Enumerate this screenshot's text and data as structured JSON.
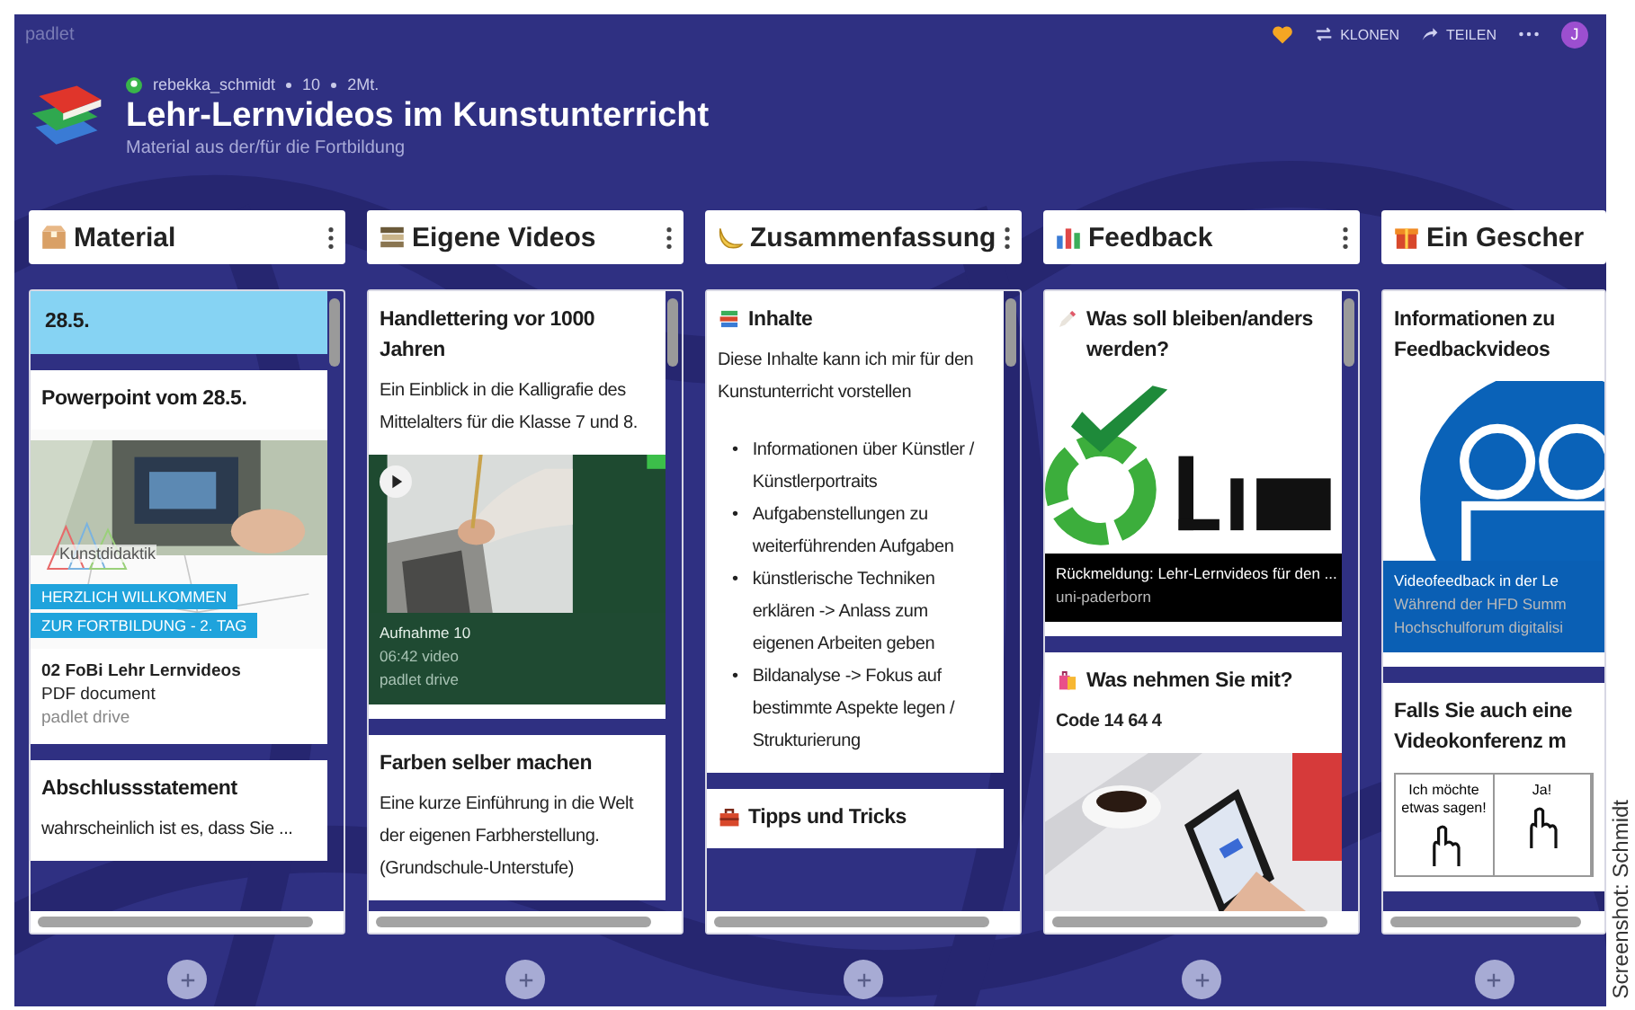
{
  "app": {
    "name": "padlet"
  },
  "toolbar": {
    "buttons": [
      {
        "label": "KLONEN"
      },
      {
        "label": "TEILEN"
      }
    ],
    "avatar": "J"
  },
  "board": {
    "author": "rebekka_schmidt",
    "likes": "10",
    "age": "2Mt.",
    "title": "Lehr-Lernvideos im Kunstunterricht",
    "subtitle": "Material aus der/für die Fortbildung"
  },
  "columns": [
    {
      "title": "Material",
      "menu": true,
      "scrollbar": true,
      "cards": [
        {
          "kind": "label",
          "title": "28.5.",
          "color": "#86d3f3"
        },
        {
          "kind": "post",
          "title": "Powerpoint vom 28.5.",
          "media": {
            "kind": "slide",
            "logo_text": "Kunstdidaktik",
            "banners": [
              "HERZLICH WILLKOMMEN",
              "ZUR FORTBILDUNG - 2. TAG"
            ],
            "lines": [
              "02 FoBi Lehr Lernvideos",
              "PDF document",
              "padlet drive"
            ]
          }
        },
        {
          "kind": "post",
          "title": "Abschlussstatement",
          "body": "wahrscheinlich ist es, dass Sie ..."
        }
      ]
    },
    {
      "title": "Eigene Videos",
      "menu": true,
      "scrollbar": true,
      "cards": [
        {
          "kind": "post",
          "title": "Handlettering vor 1000 Jahren",
          "body": "Ein Einblick in die Kalligrafie des Mittelalters für die Klasse 7 und 8.",
          "media": {
            "kind": "video",
            "color": "#1f4a32",
            "lines": [
              "Aufnahme 10",
              "06:42 video",
              "padlet drive"
            ]
          }
        },
        {
          "kind": "post",
          "title": "Farben selber machen",
          "body": "Eine kurze Einführung in die Welt der eigenen Farbherstellung. (Grundschule-Unterstufe)"
        }
      ]
    },
    {
      "title": "Zusammenfassung",
      "menu": true,
      "scrollbar": true,
      "cards": [
        {
          "kind": "post",
          "icon": true,
          "title": "Inhalte",
          "body": "Diese Inhalte kann ich mir für den Kunstunterricht vorstellen",
          "bullet": "•",
          "bullets": [
            "Informationen über Künstler / Künstlerportraits",
            "Aufgabenstellungen zu weiterführenden Aufgaben",
            "künstlerische Techniken erklären -> Anlass zum eigenen Arbeiten geben",
            "Bildanalyse -> Fokus auf bestimmte Aspekte legen / Strukturierung"
          ]
        },
        {
          "kind": "post",
          "icon": true,
          "title": "Tipps und Tricks"
        }
      ]
    },
    {
      "title": "Feedback",
      "menu": true,
      "scrollbar": true,
      "cards": [
        {
          "kind": "post",
          "icon": true,
          "title": "Was soll bleiben/anders werden?",
          "media": {
            "kind": "link",
            "color": "#000000",
            "lines": [
              "Rückmeldung: Lehr-Lernvideos für den ...",
              "uni-paderborn"
            ]
          }
        },
        {
          "kind": "post",
          "icon": true,
          "title": "Was nehmen Sie mit?",
          "body": "Code 14 64 4"
        }
      ]
    },
    {
      "title": "Ein Gescher",
      "menu": false,
      "scrollbar": false,
      "cards": [
        {
          "kind": "post",
          "title": "Informationen zu Feedbackvideos",
          "media": {
            "kind": "link",
            "color": "#0a5fb4",
            "lines": [
              "Videofeedback in der Le",
              "Während der HFD Summ",
              "Hochschulforum digitalisi"
            ]
          }
        },
        {
          "kind": "post",
          "title": "Falls Sie auch eine Videokonferenz m",
          "media": {
            "kind": "comic",
            "panels": [
              "Ich möchte etwas sagen!",
              "Ja!"
            ]
          }
        }
      ]
    }
  ],
  "credit": "Screenshot: Schmidt"
}
